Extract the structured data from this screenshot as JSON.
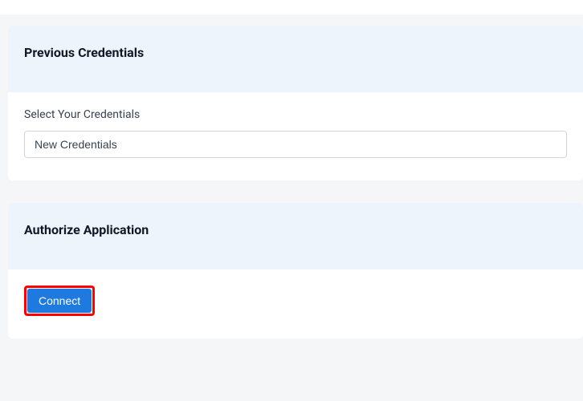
{
  "sections": {
    "previous_credentials": {
      "title": "Previous Credentials",
      "field_label": "Select Your Credentials",
      "select_value": "New Credentials"
    },
    "authorize_application": {
      "title": "Authorize Application",
      "connect_label": "Connect"
    }
  }
}
